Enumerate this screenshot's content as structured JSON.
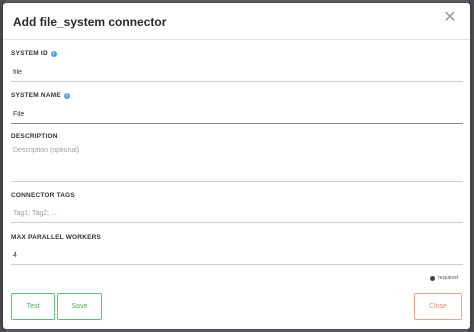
{
  "dialog": {
    "title": "Add file_system connector",
    "close_icon": "close-icon"
  },
  "fields": {
    "system_id": {
      "label": "SYSTEM ID",
      "value": "file",
      "placeholder": ""
    },
    "system_name": {
      "label": "SYSTEM NAME",
      "value": "File",
      "placeholder": ""
    },
    "description": {
      "label": "DESCRIPTION",
      "value": "",
      "placeholder": "Description (optional)"
    },
    "connector_tags": {
      "label": "CONNECTOR TAGS",
      "value": "",
      "placeholder": "Tag1; Tag2; ..."
    },
    "max_parallel_workers": {
      "label": "MAX PARALLEL WORKERS",
      "value": "4",
      "placeholder": ""
    }
  },
  "required_note": "required",
  "buttons": {
    "test": "Test",
    "save": "Save",
    "close": "Close"
  },
  "colors": {
    "primary_green": "#4ab565",
    "close_orange": "#ea8a6c",
    "info_blue": "#4a9ee0"
  }
}
